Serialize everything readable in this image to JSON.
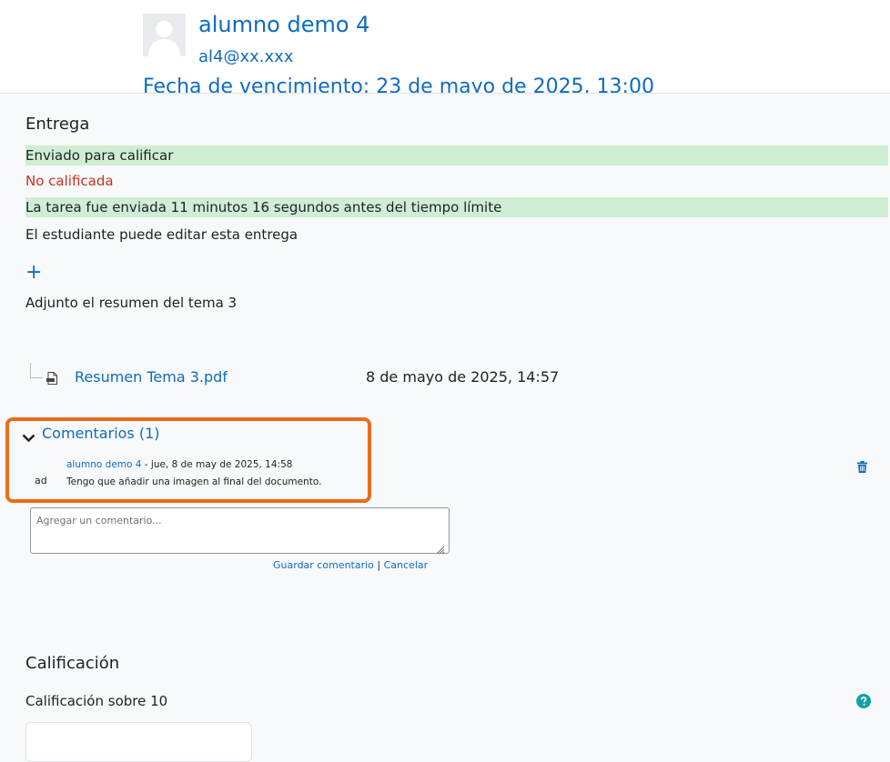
{
  "user": {
    "name": "alumno demo 4",
    "email": "al4@xx.xxx",
    "due_date": "Fecha de vencimiento: 23 de mayo de 2025, 13:00"
  },
  "submission": {
    "heading": "Entrega",
    "status_submitted": "Enviado para calificar",
    "status_grading": "No calificada",
    "time_remaining": "La tarea fue enviada 11 minutos 16 segundos antes del tiempo límite",
    "editing_status": "El estudiante puede editar esta entrega",
    "plus_icon": "+",
    "online_text": "Adjunto el resumen del tema 3",
    "file": {
      "name": "Resumen Tema 3.pdf",
      "date": "8 de mayo de 2025, 14:57"
    }
  },
  "comments": {
    "toggle_label": "Comentarios (1)",
    "items": [
      {
        "initials": "ad",
        "author": "alumno demo 4",
        "date": " - jue, 8 de may de 2025, 14:58",
        "text": "Tengo que añadir una imagen al final del documento."
      }
    ],
    "input_placeholder": "Agregar un comentario...",
    "save_label": "Guardar comentario",
    "separator": " | ",
    "cancel_label": "Cancelar"
  },
  "grade": {
    "heading": "Calificación",
    "label": "Calificación sobre 10",
    "value": ""
  },
  "colors": {
    "link": "#0f6cbf",
    "success_bg": "#cfefd4",
    "danger": "#ca3120",
    "highlight_border": "#ea6c1c",
    "panel_bg": "#f8f9fa"
  },
  "icons": {
    "avatar": "default-user-avatar",
    "file": "pdf-file-icon",
    "toggle": "chevron-down-icon",
    "delete": "trash-icon",
    "help": "question-circle-icon",
    "resize": "resize-grip-icon"
  }
}
